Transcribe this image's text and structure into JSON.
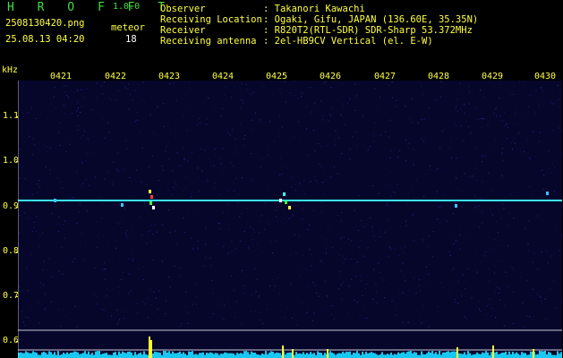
{
  "app": {
    "name": "H R O F F T",
    "version": "1.0.0"
  },
  "file": {
    "name": "2508130420.png",
    "datetime": "25.08.13 04:20"
  },
  "meteor": {
    "label": "meteor",
    "count": "18"
  },
  "info": [
    {
      "label": "Observer",
      "value": ": Takanori Kawachi"
    },
    {
      "label": "Receiving Location",
      "value": ": Ogaki, Gifu, JAPAN (136.60E, 35.35N)"
    },
    {
      "label": "Receiver",
      "value": ": R820T2(RTL-SDR) SDR-Sharp 53.372MHz"
    },
    {
      "label": "Receiving antenna",
      "value": ": 2el-HB9CV Vertical (el. E-W)"
    }
  ],
  "y_unit": "kHz",
  "hours": [
    "0421",
    "0422",
    "0423",
    "0424",
    "0425",
    "0426",
    "0427",
    "0428",
    "0429",
    "0430"
  ],
  "y_ticks": [
    "1.1",
    "1.0",
    "0.9",
    "0.8",
    "0.7",
    "0.6"
  ],
  "colors": {
    "title_green": "#3fe03f",
    "label_yellow": "#ffff40",
    "carrier_cyan": "#38e8ff",
    "bar_cyan": "#18c8f0",
    "bar_yellow": "#ffff30",
    "background_navy": "#06062a"
  }
}
